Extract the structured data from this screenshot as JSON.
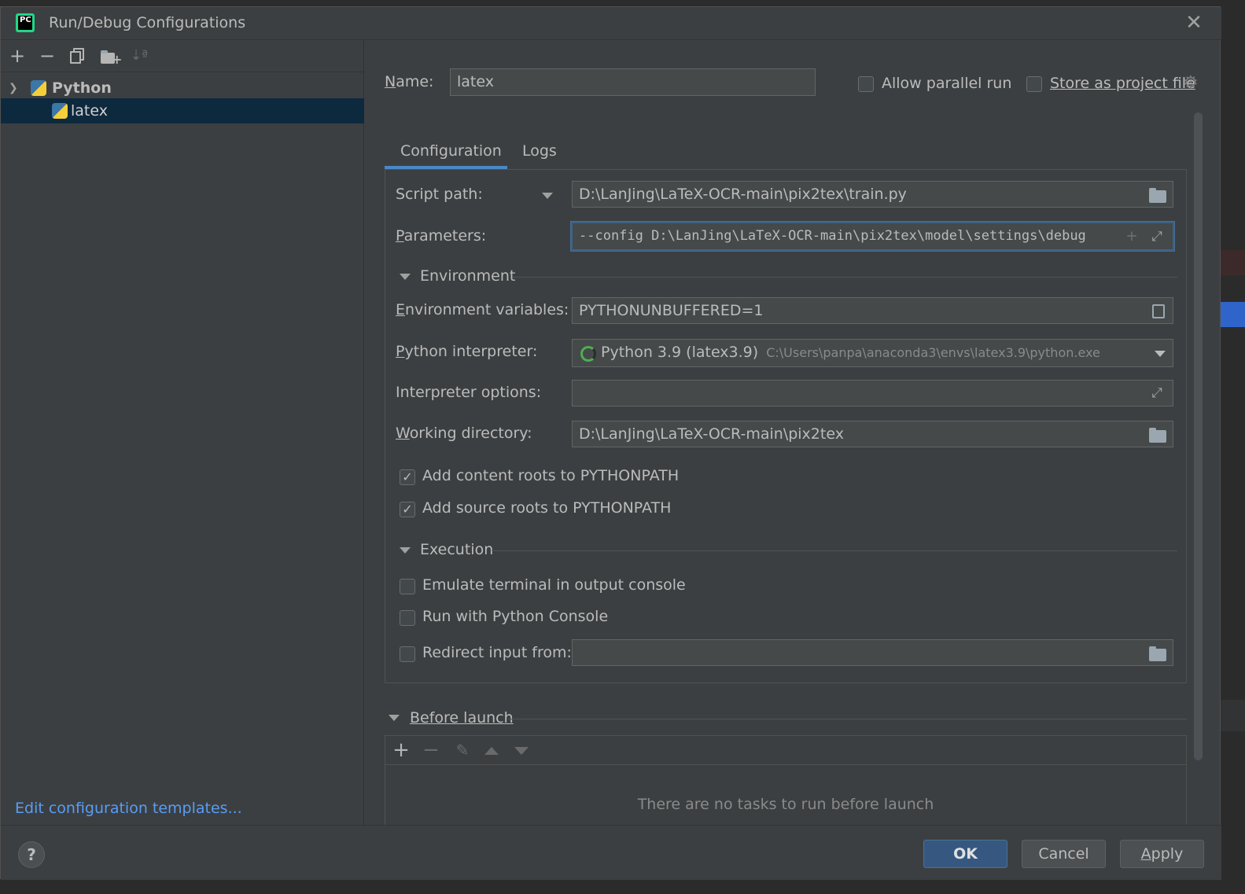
{
  "window": {
    "title": "Run/Debug Configurations"
  },
  "toolbar": {
    "add_icon": "plus-icon",
    "remove_icon": "minus-icon",
    "copy_icon": "copy-icon",
    "folder_icon": "new-folder-icon",
    "sort_icon": "sort-icon"
  },
  "tree": {
    "group_label": "Python",
    "item_label": "latex"
  },
  "edit_templates_link": "Edit configuration templates...",
  "form": {
    "name_label": "Name:",
    "name_value": "latex",
    "allow_parallel_label": "Allow parallel run",
    "store_project_label": "Store as project file",
    "tabs": [
      "Configuration",
      "Logs"
    ],
    "script_path_label": "Script path:",
    "script_path_value": "D:\\LanJing\\LaTeX-OCR-main\\pix2tex\\train.py",
    "parameters_label": "Parameters:",
    "parameters_value": "--config D:\\LanJing\\LaTeX-OCR-main\\pix2tex\\model\\settings\\debug",
    "environment_section": "Environment",
    "env_vars_label": "Environment variables:",
    "env_vars_value": "PYTHONUNBUFFERED=1",
    "interpreter_label": "Python interpreter:",
    "interpreter_name": "Python 3.9 (latex3.9)",
    "interpreter_path": "C:\\Users\\panpa\\anaconda3\\envs\\latex3.9\\python.exe",
    "interp_options_label": "Interpreter options:",
    "interp_options_value": "",
    "working_dir_label": "Working directory:",
    "working_dir_value": "D:\\LanJing\\LaTeX-OCR-main\\pix2tex",
    "add_content_roots_label": "Add content roots to PYTHONPATH",
    "add_source_roots_label": "Add source roots to PYTHONPATH",
    "execution_section": "Execution",
    "emulate_terminal_label": "Emulate terminal in output console",
    "run_python_console_label": "Run with Python Console",
    "redirect_input_label": "Redirect input from:",
    "redirect_input_value": "",
    "before_launch_section": "Before launch",
    "no_tasks_text": "There are no tasks to run before launch"
  },
  "checkboxes": {
    "allow_parallel": false,
    "store_project": false,
    "add_content_roots": true,
    "add_source_roots": true,
    "emulate_terminal": false,
    "run_python_console": false,
    "redirect_input": false
  },
  "buttons": {
    "ok": "OK",
    "cancel": "Cancel",
    "apply": "Apply",
    "help": "?"
  },
  "colors": {
    "accent": "#4a88c7",
    "selection": "#0d293e",
    "link": "#589df6",
    "primary_button": "#365880"
  }
}
